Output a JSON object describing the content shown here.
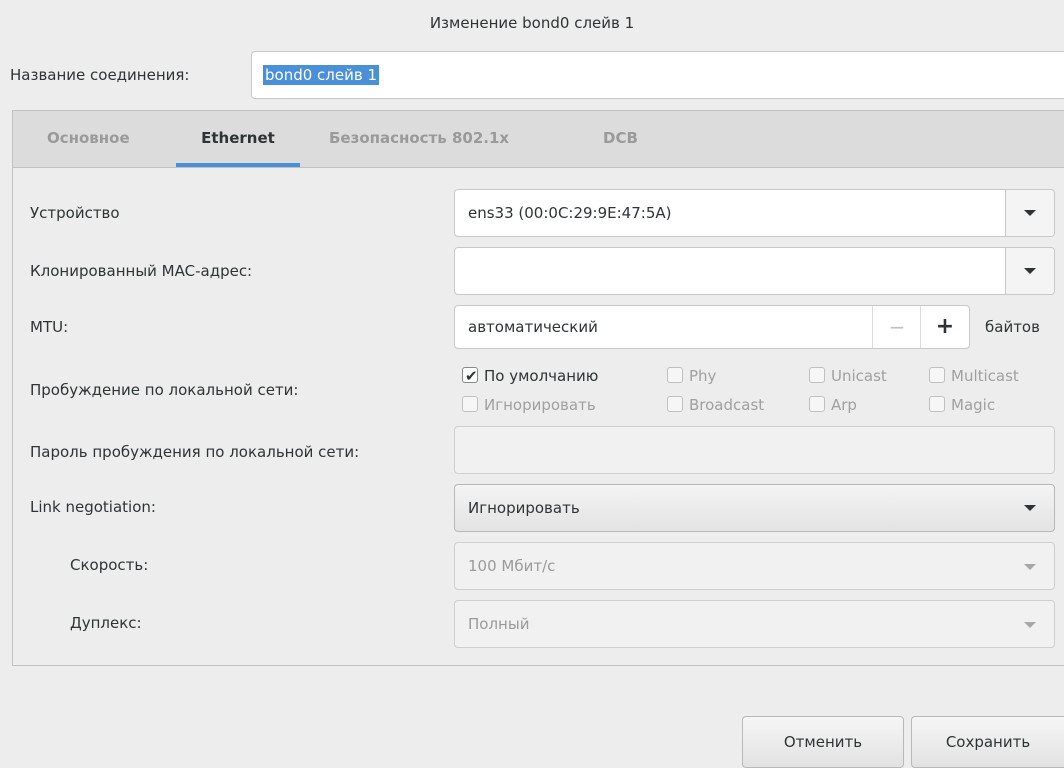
{
  "window": {
    "title": "Изменение bond0 слейв 1"
  },
  "connection": {
    "label": "Название соединения:",
    "value": "bond0 слейв 1"
  },
  "tabs": [
    {
      "label": "Основное",
      "active": false
    },
    {
      "label": "Ethernet",
      "active": true
    },
    {
      "label": "Безопасность 802.1x",
      "active": false
    },
    {
      "label": "DCB",
      "active": false
    }
  ],
  "form": {
    "device": {
      "label": "Устройство",
      "value": "ens33 (00:0C:29:9E:47:5A)"
    },
    "cloned_mac": {
      "label": "Клонированный MAC-адрес:",
      "value": ""
    },
    "mtu": {
      "label": "MTU:",
      "value": "автоматический",
      "minus": "−",
      "plus": "+",
      "unit": "байтов"
    },
    "wol": {
      "label": "Пробуждение по локальной сети:",
      "options": [
        {
          "label": "По умолчанию",
          "checked": true,
          "enabled": true
        },
        {
          "label": "Phy",
          "checked": false,
          "enabled": false
        },
        {
          "label": "Unicast",
          "checked": false,
          "enabled": false
        },
        {
          "label": "Multicast",
          "checked": false,
          "enabled": false
        },
        {
          "label": "Игнорировать",
          "checked": false,
          "enabled": false
        },
        {
          "label": "Broadcast",
          "checked": false,
          "enabled": false
        },
        {
          "label": "Arp",
          "checked": false,
          "enabled": false
        },
        {
          "label": "Magic",
          "checked": false,
          "enabled": false
        }
      ]
    },
    "wol_password": {
      "label": "Пароль пробуждения по локальной сети:",
      "value": ""
    },
    "link_negotiation": {
      "label": "Link negotiation:",
      "value": "Игнорировать"
    },
    "speed": {
      "label": "Скорость:",
      "value": "100 Мбит/с"
    },
    "duplex": {
      "label": "Дуплекс:",
      "value": "Полный"
    }
  },
  "buttons": {
    "cancel": "Отменить",
    "save": "Сохранить"
  },
  "colors": {
    "accent": "#4a90d9",
    "background": "#ededed"
  }
}
